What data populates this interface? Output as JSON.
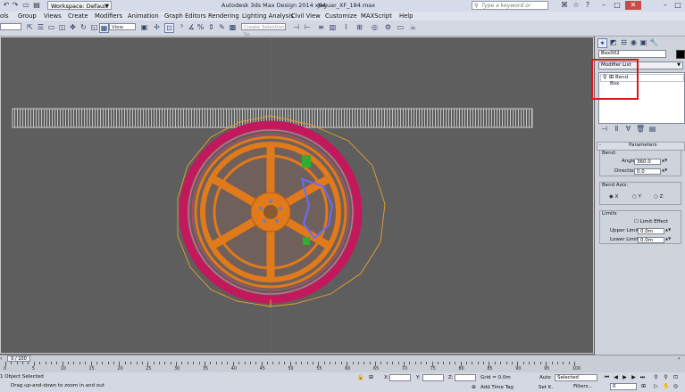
{
  "titlebar": {
    "workspace": "Workspace: Default",
    "app_title": "Autodesk 3ds Max Design 2014 x64",
    "file_title": "Jaguar_XF_184.max",
    "search_placeholder": "Type a keyword or phrase"
  },
  "menus": [
    "ols",
    "Group",
    "Views",
    "Create",
    "Modifiers",
    "Animation",
    "Graph Editors",
    "Rendering",
    "Lighting Analysis",
    "Civil View",
    "Customize",
    "MAXScript",
    "Help"
  ],
  "toolbar": {
    "selection_filter": "",
    "ref_coord": "View",
    "selection_set_placeholder": "Create Selection Se"
  },
  "panel": {
    "object_name": "Box002",
    "modifier_list": "Modifier List",
    "stack": [
      "Bend",
      "Box"
    ],
    "rollout_title": "Parameters",
    "bend_group": "Bend:",
    "angle_label": "Angle:",
    "angle_value": "360.0",
    "direction_label": "Direction:",
    "direction_value": "0.0",
    "axis_group": "Bend Axis:",
    "axis_x": "X",
    "axis_y": "Y",
    "axis_z": "Z",
    "axis_selected": "X",
    "limits_group": "Limits",
    "limit_effect": "Limit Effect",
    "upper_label": "Upper Limit:",
    "upper_value": "0.0m",
    "lower_label": "Lower Limit:",
    "lower_value": "0.0m"
  },
  "timeline": {
    "frame_counter": "0 / 100",
    "ticks": [
      "0",
      "5",
      "10",
      "15",
      "20",
      "25",
      "30",
      "35",
      "40",
      "45",
      "50",
      "55",
      "60",
      "65",
      "70",
      "75",
      "80",
      "85",
      "90",
      "95",
      "100"
    ]
  },
  "status": {
    "selection": "1 Object Selected",
    "prompt": "Drag up-and-down to zoom in and out",
    "x_label": "X:",
    "y_label": "Y:",
    "z_label": "Z:",
    "grid": "Grid = 0.0m",
    "add_time_tag": "Add Time Tag",
    "auto": "Auto",
    "set_key": "Set K.",
    "key_filter": "Selected",
    "filters": "Filters...",
    "frame": "0"
  },
  "colors": {
    "viewport_bg": "#5e5e5e",
    "wheel": "#e07a1a",
    "tire": "#c0185a",
    "highlight_box": "#e0141c"
  }
}
